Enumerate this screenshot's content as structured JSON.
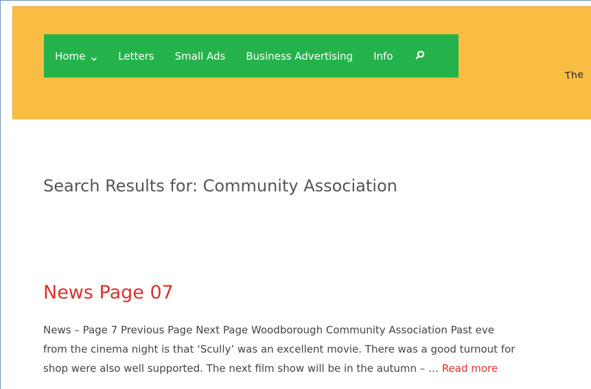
{
  "nav": {
    "items": [
      {
        "label": "Home",
        "has_dropdown": true
      },
      {
        "label": "Letters"
      },
      {
        "label": "Small Ads"
      },
      {
        "label": "Business Advertising"
      },
      {
        "label": "Info"
      }
    ],
    "search_icon": "search-icon"
  },
  "header": {
    "tagline_partial": "The"
  },
  "page": {
    "search_title": "Search Results for: Community Association"
  },
  "result": {
    "title": "News Page 07",
    "excerpt_line1": "News – Page 7 Previous Page     Next Page Woodborough Community Association Past eve",
    "excerpt_line2": "from the cinema night is that ‘Scully’ was an excellent movie. There was a good turnout for",
    "excerpt_line3": "shop were also well supported. The next film show will be in the autumn – … ",
    "read_more": "Read more"
  },
  "colors": {
    "header_bg": "#f9bd44",
    "nav_bg": "#24b34b",
    "accent_red": "#d9322e",
    "text_gray": "#444444"
  }
}
